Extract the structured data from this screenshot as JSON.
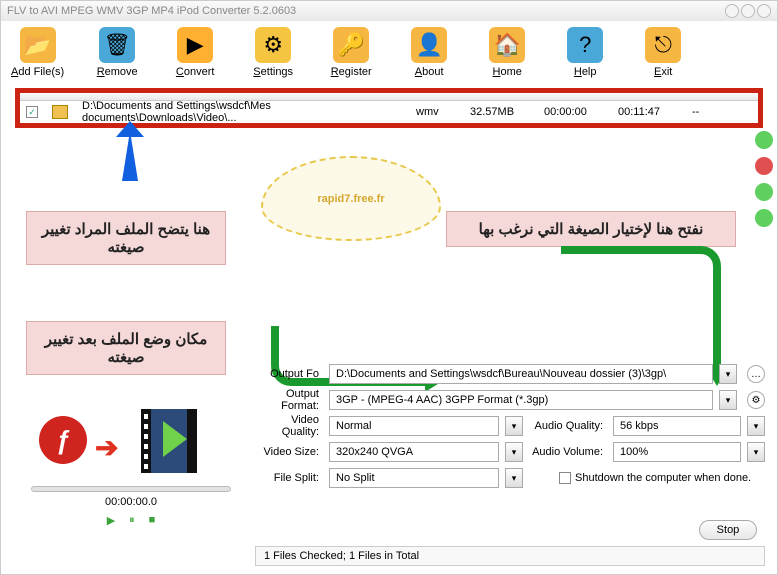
{
  "title": "FLV to AVI MPEG WMV 3GP MP4 iPod Converter 5.2.0603",
  "toolbar": [
    {
      "label": "Add File(s)",
      "icon": "📂",
      "bg": "#f5b642"
    },
    {
      "label": "Remove",
      "icon": "🗑",
      "bg": "#4aa8d8"
    },
    {
      "label": "Convert",
      "icon": "▶",
      "bg": "#ffb030"
    },
    {
      "label": "Settings",
      "icon": "⚙",
      "bg": "#f5c542"
    },
    {
      "label": "Register",
      "icon": "🔑",
      "bg": "#f5b642"
    },
    {
      "label": "About",
      "icon": "👤",
      "bg": "#f5b642"
    },
    {
      "label": "Home",
      "icon": "🏠",
      "bg": "#f5b642"
    },
    {
      "label": "Help",
      "icon": "?",
      "bg": "#4aa8d8"
    },
    {
      "label": "Exit",
      "icon": "⎋",
      "bg": "#f5b642"
    }
  ],
  "file": {
    "path": "D:\\Documents and Settings\\wsdcf\\Mes documents\\Downloads\\Video\\...",
    "ext": "wmv",
    "size": "32.57MB",
    "start": "00:00:00",
    "dur": "00:11:47",
    "dash": "--"
  },
  "cloud": "rapid7.free.fr",
  "anno1": "هنا يتضح الملف المراد تغيير صيغته",
  "anno2": "نفتح هنا لإختيار الصيغة التي نرغب بها",
  "anno3": "مكان وضع الملف بعد تغيير صيغته",
  "settings": {
    "folder_lbl": "Output Fo",
    "folder": "D:\\Documents and Settings\\wsdcf\\Bureau\\Nouveau dossier (3)\\3gp\\",
    "format_lbl": "Output Format:",
    "format": "3GP - (MPEG-4 AAC) 3GPP Format (*.3gp)",
    "vq_lbl": "Video Quality:",
    "vq": "Normal",
    "aq_lbl": "Audio Quality:",
    "aq": "56  kbps",
    "vs_lbl": "Video Size:",
    "vs": "320x240    QVGA",
    "av_lbl": "Audio Volume:",
    "av": "100%",
    "fs_lbl": "File Split:",
    "fs": "No Split",
    "shutdown": "Shutdown the computer when done."
  },
  "time": "00:00:00.0",
  "stop": "Stop",
  "status": "1 Files Checked; 1 Files in Total"
}
